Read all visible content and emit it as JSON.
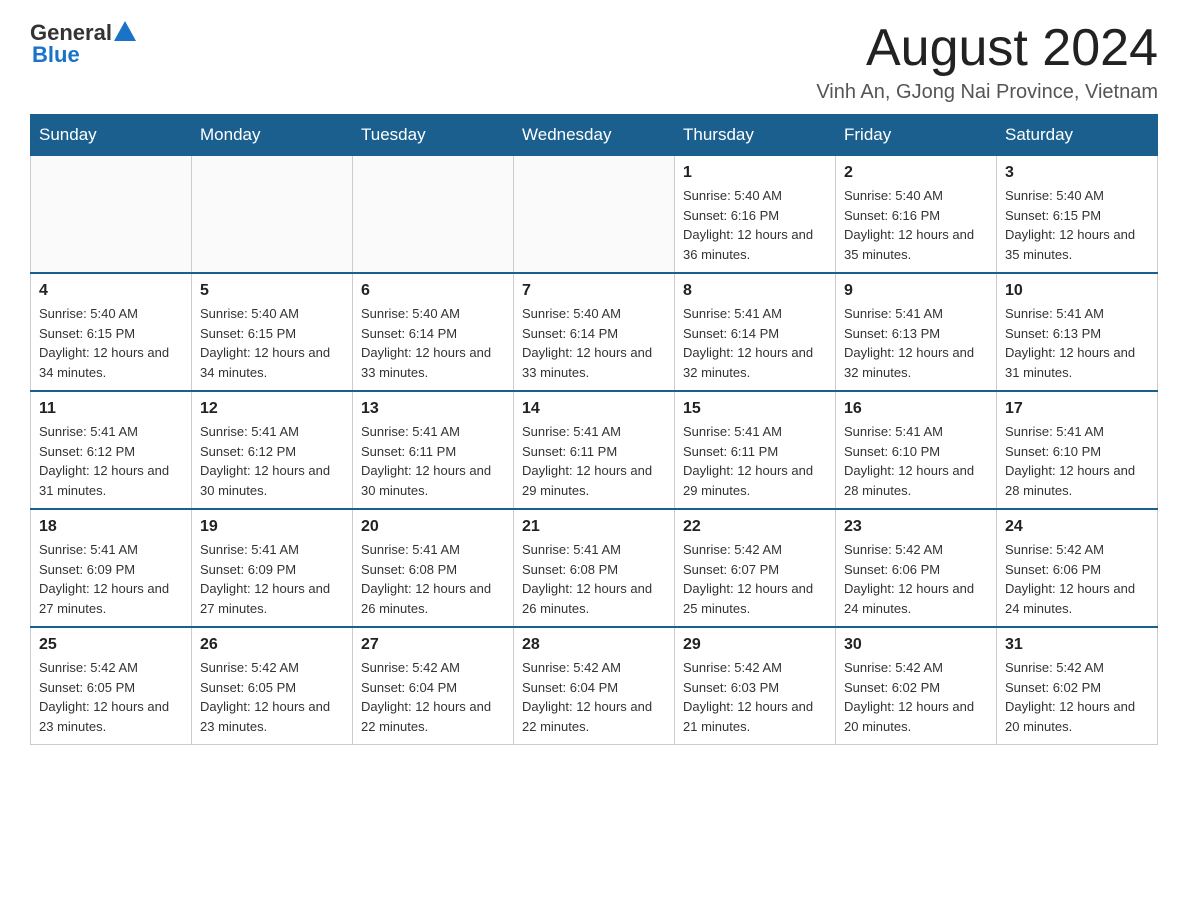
{
  "header": {
    "logo": {
      "general": "General",
      "blue": "Blue"
    },
    "title": "August 2024",
    "location": "Vinh An, GJong Nai Province, Vietnam"
  },
  "days_of_week": [
    "Sunday",
    "Monday",
    "Tuesday",
    "Wednesday",
    "Thursday",
    "Friday",
    "Saturday"
  ],
  "weeks": [
    [
      {
        "day": "",
        "info": ""
      },
      {
        "day": "",
        "info": ""
      },
      {
        "day": "",
        "info": ""
      },
      {
        "day": "",
        "info": ""
      },
      {
        "day": "1",
        "info": "Sunrise: 5:40 AM\nSunset: 6:16 PM\nDaylight: 12 hours and 36 minutes."
      },
      {
        "day": "2",
        "info": "Sunrise: 5:40 AM\nSunset: 6:16 PM\nDaylight: 12 hours and 35 minutes."
      },
      {
        "day": "3",
        "info": "Sunrise: 5:40 AM\nSunset: 6:15 PM\nDaylight: 12 hours and 35 minutes."
      }
    ],
    [
      {
        "day": "4",
        "info": "Sunrise: 5:40 AM\nSunset: 6:15 PM\nDaylight: 12 hours and 34 minutes."
      },
      {
        "day": "5",
        "info": "Sunrise: 5:40 AM\nSunset: 6:15 PM\nDaylight: 12 hours and 34 minutes."
      },
      {
        "day": "6",
        "info": "Sunrise: 5:40 AM\nSunset: 6:14 PM\nDaylight: 12 hours and 33 minutes."
      },
      {
        "day": "7",
        "info": "Sunrise: 5:40 AM\nSunset: 6:14 PM\nDaylight: 12 hours and 33 minutes."
      },
      {
        "day": "8",
        "info": "Sunrise: 5:41 AM\nSunset: 6:14 PM\nDaylight: 12 hours and 32 minutes."
      },
      {
        "day": "9",
        "info": "Sunrise: 5:41 AM\nSunset: 6:13 PM\nDaylight: 12 hours and 32 minutes."
      },
      {
        "day": "10",
        "info": "Sunrise: 5:41 AM\nSunset: 6:13 PM\nDaylight: 12 hours and 31 minutes."
      }
    ],
    [
      {
        "day": "11",
        "info": "Sunrise: 5:41 AM\nSunset: 6:12 PM\nDaylight: 12 hours and 31 minutes."
      },
      {
        "day": "12",
        "info": "Sunrise: 5:41 AM\nSunset: 6:12 PM\nDaylight: 12 hours and 30 minutes."
      },
      {
        "day": "13",
        "info": "Sunrise: 5:41 AM\nSunset: 6:11 PM\nDaylight: 12 hours and 30 minutes."
      },
      {
        "day": "14",
        "info": "Sunrise: 5:41 AM\nSunset: 6:11 PM\nDaylight: 12 hours and 29 minutes."
      },
      {
        "day": "15",
        "info": "Sunrise: 5:41 AM\nSunset: 6:11 PM\nDaylight: 12 hours and 29 minutes."
      },
      {
        "day": "16",
        "info": "Sunrise: 5:41 AM\nSunset: 6:10 PM\nDaylight: 12 hours and 28 minutes."
      },
      {
        "day": "17",
        "info": "Sunrise: 5:41 AM\nSunset: 6:10 PM\nDaylight: 12 hours and 28 minutes."
      }
    ],
    [
      {
        "day": "18",
        "info": "Sunrise: 5:41 AM\nSunset: 6:09 PM\nDaylight: 12 hours and 27 minutes."
      },
      {
        "day": "19",
        "info": "Sunrise: 5:41 AM\nSunset: 6:09 PM\nDaylight: 12 hours and 27 minutes."
      },
      {
        "day": "20",
        "info": "Sunrise: 5:41 AM\nSunset: 6:08 PM\nDaylight: 12 hours and 26 minutes."
      },
      {
        "day": "21",
        "info": "Sunrise: 5:41 AM\nSunset: 6:08 PM\nDaylight: 12 hours and 26 minutes."
      },
      {
        "day": "22",
        "info": "Sunrise: 5:42 AM\nSunset: 6:07 PM\nDaylight: 12 hours and 25 minutes."
      },
      {
        "day": "23",
        "info": "Sunrise: 5:42 AM\nSunset: 6:06 PM\nDaylight: 12 hours and 24 minutes."
      },
      {
        "day": "24",
        "info": "Sunrise: 5:42 AM\nSunset: 6:06 PM\nDaylight: 12 hours and 24 minutes."
      }
    ],
    [
      {
        "day": "25",
        "info": "Sunrise: 5:42 AM\nSunset: 6:05 PM\nDaylight: 12 hours and 23 minutes."
      },
      {
        "day": "26",
        "info": "Sunrise: 5:42 AM\nSunset: 6:05 PM\nDaylight: 12 hours and 23 minutes."
      },
      {
        "day": "27",
        "info": "Sunrise: 5:42 AM\nSunset: 6:04 PM\nDaylight: 12 hours and 22 minutes."
      },
      {
        "day": "28",
        "info": "Sunrise: 5:42 AM\nSunset: 6:04 PM\nDaylight: 12 hours and 22 minutes."
      },
      {
        "day": "29",
        "info": "Sunrise: 5:42 AM\nSunset: 6:03 PM\nDaylight: 12 hours and 21 minutes."
      },
      {
        "day": "30",
        "info": "Sunrise: 5:42 AM\nSunset: 6:02 PM\nDaylight: 12 hours and 20 minutes."
      },
      {
        "day": "31",
        "info": "Sunrise: 5:42 AM\nSunset: 6:02 PM\nDaylight: 12 hours and 20 minutes."
      }
    ]
  ]
}
